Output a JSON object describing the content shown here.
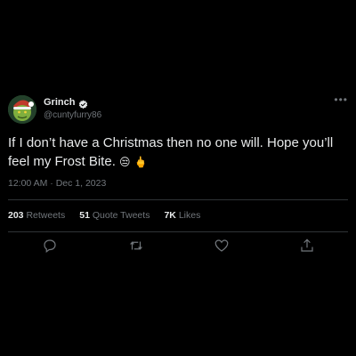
{
  "tweet": {
    "display_name": "Grinch",
    "handle": "@cuntyfurry86",
    "verified": true,
    "text": "If I don’t have a Christmas then no one will. Hope you’ll feel my Frost Bite.",
    "emojis": [
      "😒",
      "🖕"
    ],
    "timestamp": "12:00 AM · Dec 1, 2023",
    "stats": {
      "retweets": {
        "count": "203",
        "label": "Retweets"
      },
      "quote_tweets": {
        "count": "51",
        "label": "Quote Tweets"
      },
      "likes": {
        "count": "7K",
        "label": "Likes"
      }
    },
    "more_label": "•••"
  },
  "icons": {
    "avatar": "grinch-avatar",
    "verified": "verified-badge-icon",
    "more": "more-options-icon",
    "reply": "reply-icon",
    "retweet": "retweet-icon",
    "like": "heart-icon",
    "share": "share-icon"
  },
  "colors": {
    "background": "#000000",
    "text": "#e7e9ea",
    "secondary": "#71767b",
    "divider": "#2f3336"
  }
}
